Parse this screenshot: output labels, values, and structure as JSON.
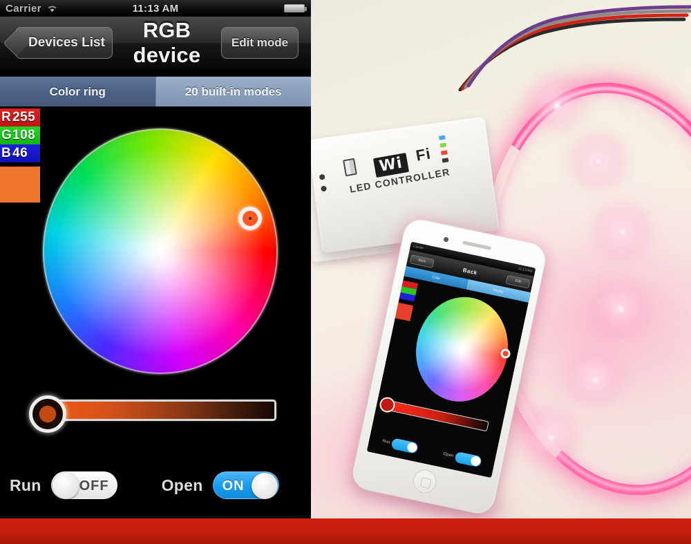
{
  "app": {
    "status_bar": {
      "carrier": "Carrier",
      "wifi_icon": "wifi-icon",
      "time": "11:13 AM",
      "battery_icon": "battery-icon"
    },
    "nav_bar": {
      "back_label": "Devices List",
      "title": "RGB device",
      "edit_label": "Edit mode"
    },
    "tabs": [
      {
        "label": "Color ring",
        "selected": true
      },
      {
        "label": "20 built-in modes",
        "selected": false
      }
    ],
    "rgb": {
      "r_channel": "R",
      "r_value": "255",
      "g_channel": "G",
      "g_value": "108",
      "b_channel": "B",
      "b_value": "46",
      "swatch_color": "#f2772e"
    },
    "color_wheel": {
      "name": "color-ring-picker",
      "cursor_color": "#ff5a20"
    },
    "brightness_slider": {
      "name": "brightness-slider",
      "position_percent": "0"
    },
    "controls": [
      {
        "label": "Run",
        "state": "OFF",
        "on": false
      },
      {
        "label": "Open",
        "state": "ON",
        "on": true
      }
    ]
  },
  "photo": {
    "controller": {
      "brand_wifi": "Wi",
      "brand_fi": "Fi",
      "subtitle": "LED CONTROLLER"
    },
    "phone_screen": {
      "nav_back": "Back",
      "nav_title": "Back",
      "nav_right": "Edit",
      "tab_left": "Color",
      "tab_right": "Modes"
    }
  },
  "colors": {
    "banner_red": "#c41d0e",
    "accent_blue": "#159bf0",
    "rgb_red": "#e02020",
    "rgb_green": "#21d821",
    "rgb_blue": "#1d1de0"
  }
}
